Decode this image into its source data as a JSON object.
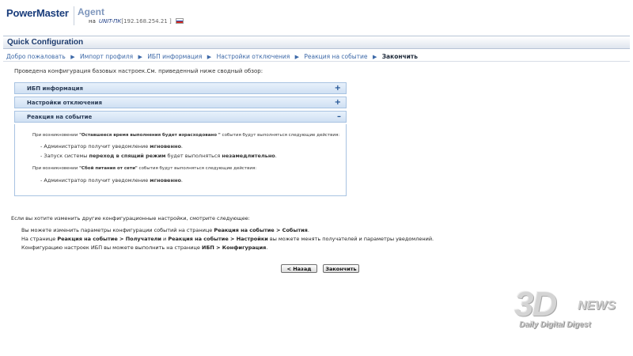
{
  "header": {
    "logo": "PowerMaster",
    "agent": "Agent",
    "on_label": "на",
    "host": "UNIT-ПК",
    "ip": "[192.168.254.21 ]",
    "flag_icon": "russian-flag-icon",
    "flag_colors": [
      "#ffffff",
      "#1f48b8",
      "#d52b1e"
    ]
  },
  "title": "Quick Configuration",
  "breadcrumb": {
    "separator_icon": "triangle-right-icon",
    "items": [
      {
        "label": "Добро пожаловать"
      },
      {
        "label": "Импорт профиля"
      },
      {
        "label": "ИБП информация"
      },
      {
        "label": "Настройки отключения"
      },
      {
        "label": "Реакция на событие"
      },
      {
        "label": "Закончить"
      }
    ]
  },
  "intro": "Проведена конфигурация базовых настроек.См. приведенный ниже сводный обзор:",
  "panels": [
    {
      "label": "ИБП информация",
      "toggle": "+"
    },
    {
      "label": "Настройки отключения",
      "toggle": "+"
    },
    {
      "label": "Реакция на событие",
      "toggle": "–"
    }
  ],
  "event_details": {
    "block1_pre": "При возникновении ",
    "block1_event": "\"Оставшееся время выполнения будет израсходовано \"",
    "block1_post": " события будут выполняться следующие действия:",
    "item1_pre": "- Администратор получит уведомление ",
    "item1_bold": "мгновенно",
    "item1_post": ".",
    "item2_pre": "- Запуск системы ",
    "item2_bold1": "переход в спящий режим",
    "item2_mid": " будет выполняться ",
    "item2_bold2": "незамедлительно",
    "item2_post": ".",
    "block2_pre": "При возникновении ",
    "block2_event": "\"Сбой питания от сети\"",
    "block2_post": " события будут выполняться следующие действия:",
    "item3_pre": "- Администратор получит уведомление ",
    "item3_bold": "мгновенно",
    "item3_post": "."
  },
  "bottom": {
    "intro": "Если вы хотите изменить другие конфигурационные настройки, смотрите следующее:",
    "line1_pre": "Вы можете изменить параметры конфигурации событий на странице ",
    "line1_link": "Реакция на событие > События",
    "line1_post": ".",
    "line2_pre": "На странице ",
    "line2_link1": "Реакция на событие > Получатели",
    "line2_mid": " и ",
    "line2_link2": "Реакция на событие > Настройки",
    "line2_post": " вы можете менять получателей и параметры уведомлений.",
    "line3_pre": "Конфигурацию настроек ИБП вы можете выполнить на странице ",
    "line3_link": "ИБП > Конфигурация",
    "line3_post": "."
  },
  "buttons": {
    "back": "< Назад",
    "finish": "Закончить"
  },
  "watermark": {
    "big": "3D",
    "news": "NEWS",
    "sub": "Daily Digital Digest"
  }
}
